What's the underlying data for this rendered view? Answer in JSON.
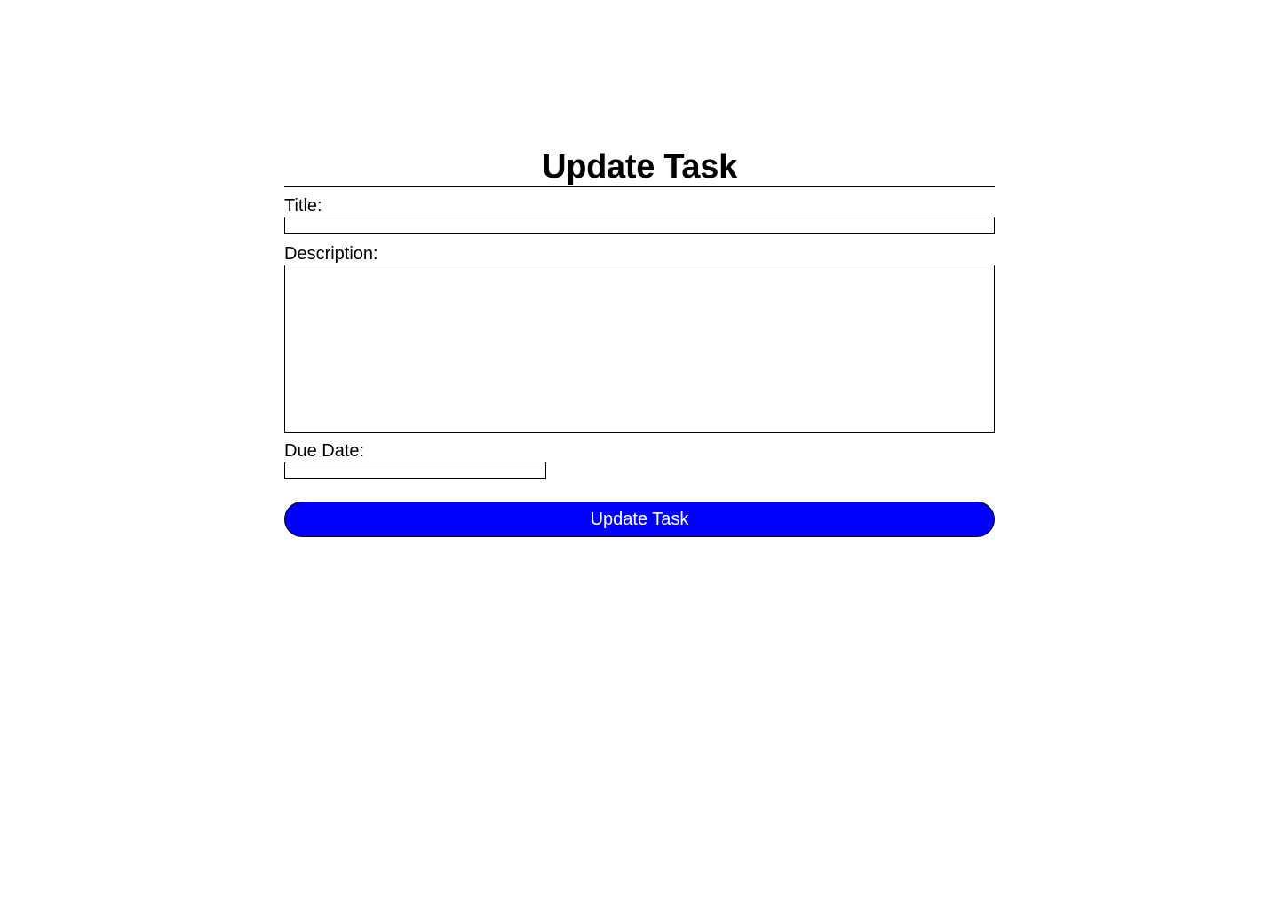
{
  "page": {
    "title": "Update Task"
  },
  "form": {
    "title_label": "Title:",
    "title_value": "",
    "description_label": "Description:",
    "description_value": "",
    "due_date_label": "Due Date:",
    "due_date_value": "",
    "submit_label": "Update Task"
  },
  "colors": {
    "button_background": "#0000ff",
    "button_text": "#ffffff"
  }
}
